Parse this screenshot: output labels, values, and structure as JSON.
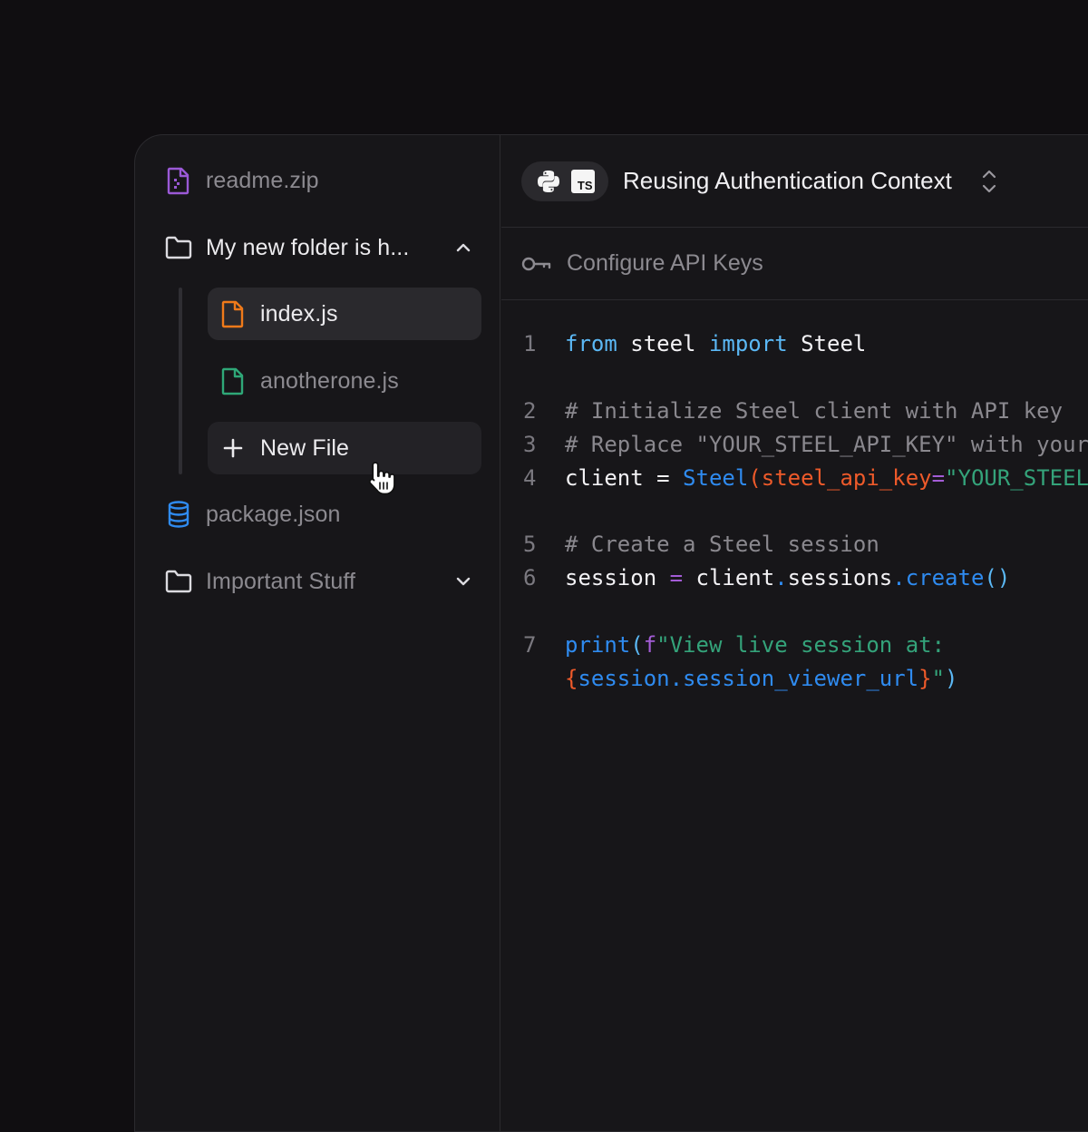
{
  "sidebar": {
    "items": [
      {
        "label": "readme.zip",
        "icon": "zip-file-icon",
        "color": "#9b59d6"
      },
      {
        "label": "My new folder is h...",
        "icon": "folder-icon",
        "expanded": true
      },
      {
        "label": "index.js",
        "icon": "file-icon",
        "color": "#f07a1a",
        "selected": true
      },
      {
        "label": "anotherone.js",
        "icon": "file-icon",
        "color": "#2fa878"
      },
      {
        "label": "New File",
        "icon": "plus-icon"
      },
      {
        "label": "package.json",
        "icon": "database-icon",
        "color": "#2f8bf0"
      },
      {
        "label": "Important Stuff",
        "icon": "folder-icon",
        "expanded": false
      }
    ]
  },
  "editor": {
    "languages": [
      "Python",
      "TS"
    ],
    "title": "Reusing Authentication Context",
    "subbar_label": "Configure API Keys",
    "line_numbers": [
      "1",
      "2",
      "3",
      "4",
      "5",
      "6",
      "7"
    ],
    "code": {
      "l1": {
        "from": "from",
        "mod": " steel ",
        "import": "import",
        "name": " Steel"
      },
      "l2": "# Initialize Steel client with API key",
      "l3": "# Replace \"YOUR_STEEL_API_KEY\" with your actual API key",
      "l4": {
        "var": "client = ",
        "fn": "Steel",
        "open": "(",
        "param": "steel_api_key",
        "eq": "=",
        "str": "\"YOUR_STEEL_API_KEY\""
      },
      "l5": "# Create a Steel session",
      "l6": {
        "var": "session ",
        "eq": "=",
        "obj": " client",
        "dot1": ".",
        "attr": "sessions",
        "dot2": ".",
        "fn": "create",
        "call": "()"
      },
      "l7a": {
        "fn": "print",
        "open": "(",
        "f": "f",
        "str": "\"View live session at:"
      },
      "l7b": {
        "lbrace": "{",
        "expr": "session.session_viewer_url",
        "rbrace": "}",
        "str": "\"",
        "close": ")"
      }
    }
  }
}
